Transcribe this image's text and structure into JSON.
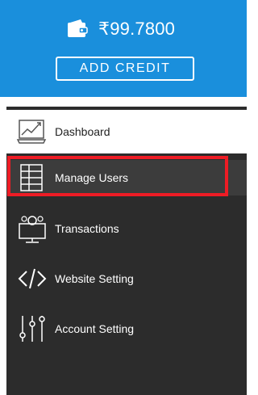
{
  "wallet": {
    "icon": "wallet-icon",
    "balance": "₹99.7800",
    "add_credit_label": "ADD CREDIT"
  },
  "nav": {
    "items": [
      {
        "label": "Dashboard",
        "icon": "dashboard-chart-icon",
        "state": "active"
      },
      {
        "label": "Manage Users",
        "icon": "users-table-icon",
        "state": "hovered"
      },
      {
        "label": "Transactions",
        "icon": "transactions-monitor-icon"
      },
      {
        "label": "Website Setting",
        "icon": "code-icon"
      },
      {
        "label": "Account Setting",
        "icon": "sliders-icon"
      }
    ]
  },
  "colors": {
    "header_bg": "#1a8fdc",
    "sidebar_bg": "#2c2c2c",
    "hover_bg": "#3c3c3c",
    "highlight_border": "#ee1c25"
  }
}
